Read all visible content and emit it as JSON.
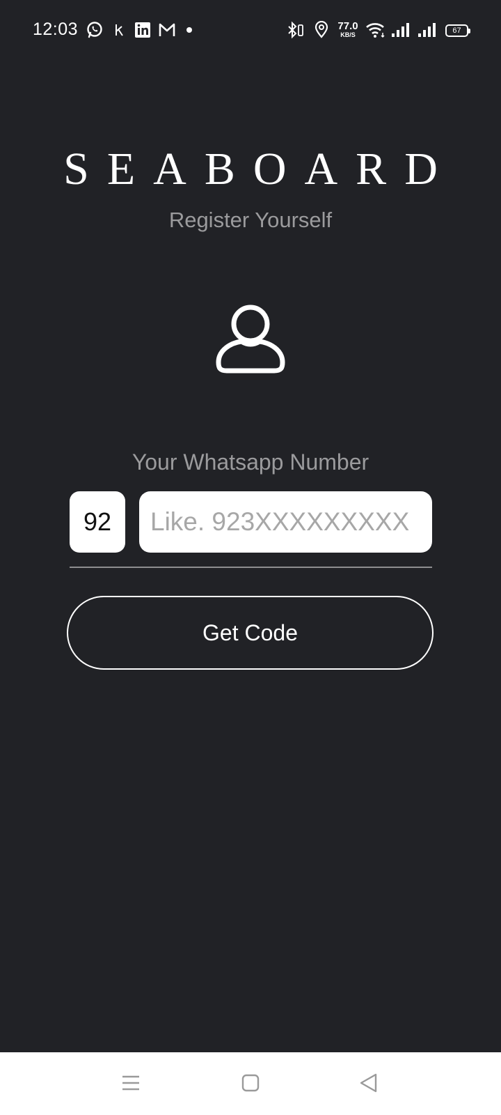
{
  "status_bar": {
    "time": "12:03",
    "net_speed_value": "77.0",
    "net_speed_unit": "KB/S",
    "battery": "67",
    "icons": [
      "whatsapp-icon",
      "k-notification-icon",
      "linkedin-icon",
      "gmail-icon",
      "dot-icon",
      "bluetooth-icon",
      "location-icon",
      "wifi-icon",
      "signal-icon",
      "signal-icon",
      "battery-icon"
    ]
  },
  "header": {
    "brand": "SEABOARD",
    "subtitle": "Register Yourself"
  },
  "form": {
    "phone_label": "Your Whatsapp Number",
    "country_code": "92",
    "phone_placeholder": "Like. 923XXXXXXXXX",
    "phone_value": "",
    "submit_label": "Get Code"
  },
  "nav_bar": {
    "buttons": [
      "menu-icon",
      "home-icon",
      "back-icon"
    ]
  },
  "colors": {
    "background": "#212226",
    "muted_text": "#9b9b9d",
    "field_background": "#ffffff"
  }
}
